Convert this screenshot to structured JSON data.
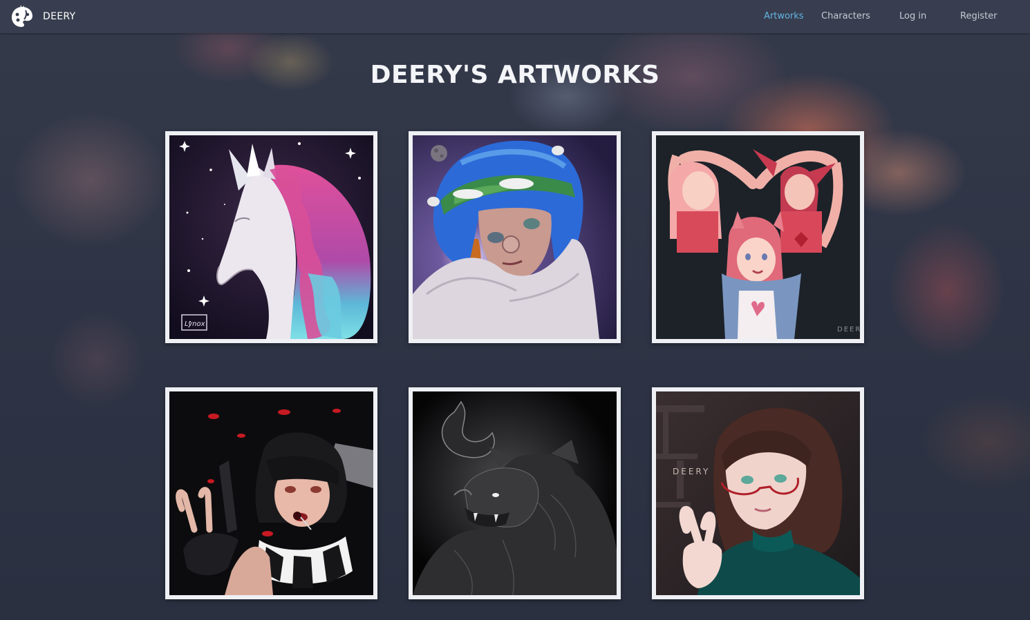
{
  "nav": {
    "brand": "DEERY",
    "links": [
      {
        "label": "Artworks",
        "active": true
      },
      {
        "label": "Characters",
        "active": false
      },
      {
        "label": "Log in",
        "active": false
      },
      {
        "label": "Register",
        "active": false
      }
    ]
  },
  "page": {
    "title": "DEERY'S ARTWORKS"
  },
  "artworks": [
    {
      "subject": "Pastel unicorn with rainbow mane in starry sky",
      "signature": "Lynox"
    },
    {
      "subject": "Girl with blue hair wearing Earth as hat in space",
      "signature": ""
    },
    {
      "subject": "Three pink-haired girls forming a heart with their arms",
      "signature": "DEERY"
    },
    {
      "subject": "Dark-haired girl with knife and lollipop among red petals",
      "signature": ""
    },
    {
      "subject": "Horned black werewolf monster in monochrome",
      "signature": ""
    },
    {
      "subject": "Girl with glasses and green sweater making peace sign",
      "signature": "DEERY"
    }
  ],
  "colors": {
    "navbar": "#383e4f",
    "active_link": "#63b4e3",
    "link": "#c6cad4",
    "card_border": "#eef0f4",
    "background": "#2d3344"
  }
}
